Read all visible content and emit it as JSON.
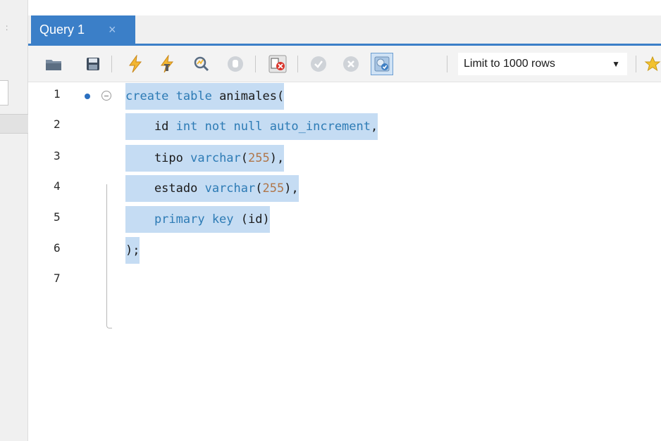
{
  "tab": {
    "title": "Query 1",
    "close_glyph": "×"
  },
  "left_grip": ":",
  "toolbar": {
    "icons": [
      "open-folder-icon",
      "save-icon",
      "execute-icon",
      "execute-current-icon",
      "explain-icon",
      "stop-icon",
      "toggle-error-icon",
      "commit-icon",
      "rollback-icon",
      "autocommit-icon",
      "snippets-icon"
    ],
    "limit_select": {
      "selected": "Limit to 1000 rows",
      "arrow": "▼"
    }
  },
  "editor": {
    "lines": [
      {
        "num": "1",
        "tokens": [
          {
            "t": "create table ",
            "k": "kw"
          },
          {
            "t": "animales(",
            "k": ""
          }
        ]
      },
      {
        "num": "2",
        "tokens": [
          {
            "t": "    id ",
            "k": ""
          },
          {
            "t": "int not null auto_increment",
            "k": "kw"
          },
          {
            "t": ",",
            "k": ""
          }
        ]
      },
      {
        "num": "3",
        "tokens": [
          {
            "t": "    tipo ",
            "k": ""
          },
          {
            "t": "varchar",
            "k": "kw"
          },
          {
            "t": "(",
            "k": ""
          },
          {
            "t": "255",
            "k": "num"
          },
          {
            "t": "),",
            "k": ""
          }
        ]
      },
      {
        "num": "4",
        "tokens": [
          {
            "t": "    estado ",
            "k": ""
          },
          {
            "t": "varchar",
            "k": "kw"
          },
          {
            "t": "(",
            "k": ""
          },
          {
            "t": "255",
            "k": "num"
          },
          {
            "t": "),",
            "k": ""
          }
        ]
      },
      {
        "num": "5",
        "tokens": [
          {
            "t": "    primary key ",
            "k": "kw"
          },
          {
            "t": "(id)",
            "k": ""
          }
        ]
      },
      {
        "num": "6",
        "tokens": [
          {
            "t": ");",
            "k": ""
          }
        ]
      },
      {
        "num": "7",
        "tokens": []
      }
    ]
  },
  "colors": {
    "tab_active": "#3b7fc8",
    "selection": "#c5dcf3",
    "keyword": "#2d7bb5",
    "number": "#b0764a",
    "marker": "#2a6fc0"
  }
}
